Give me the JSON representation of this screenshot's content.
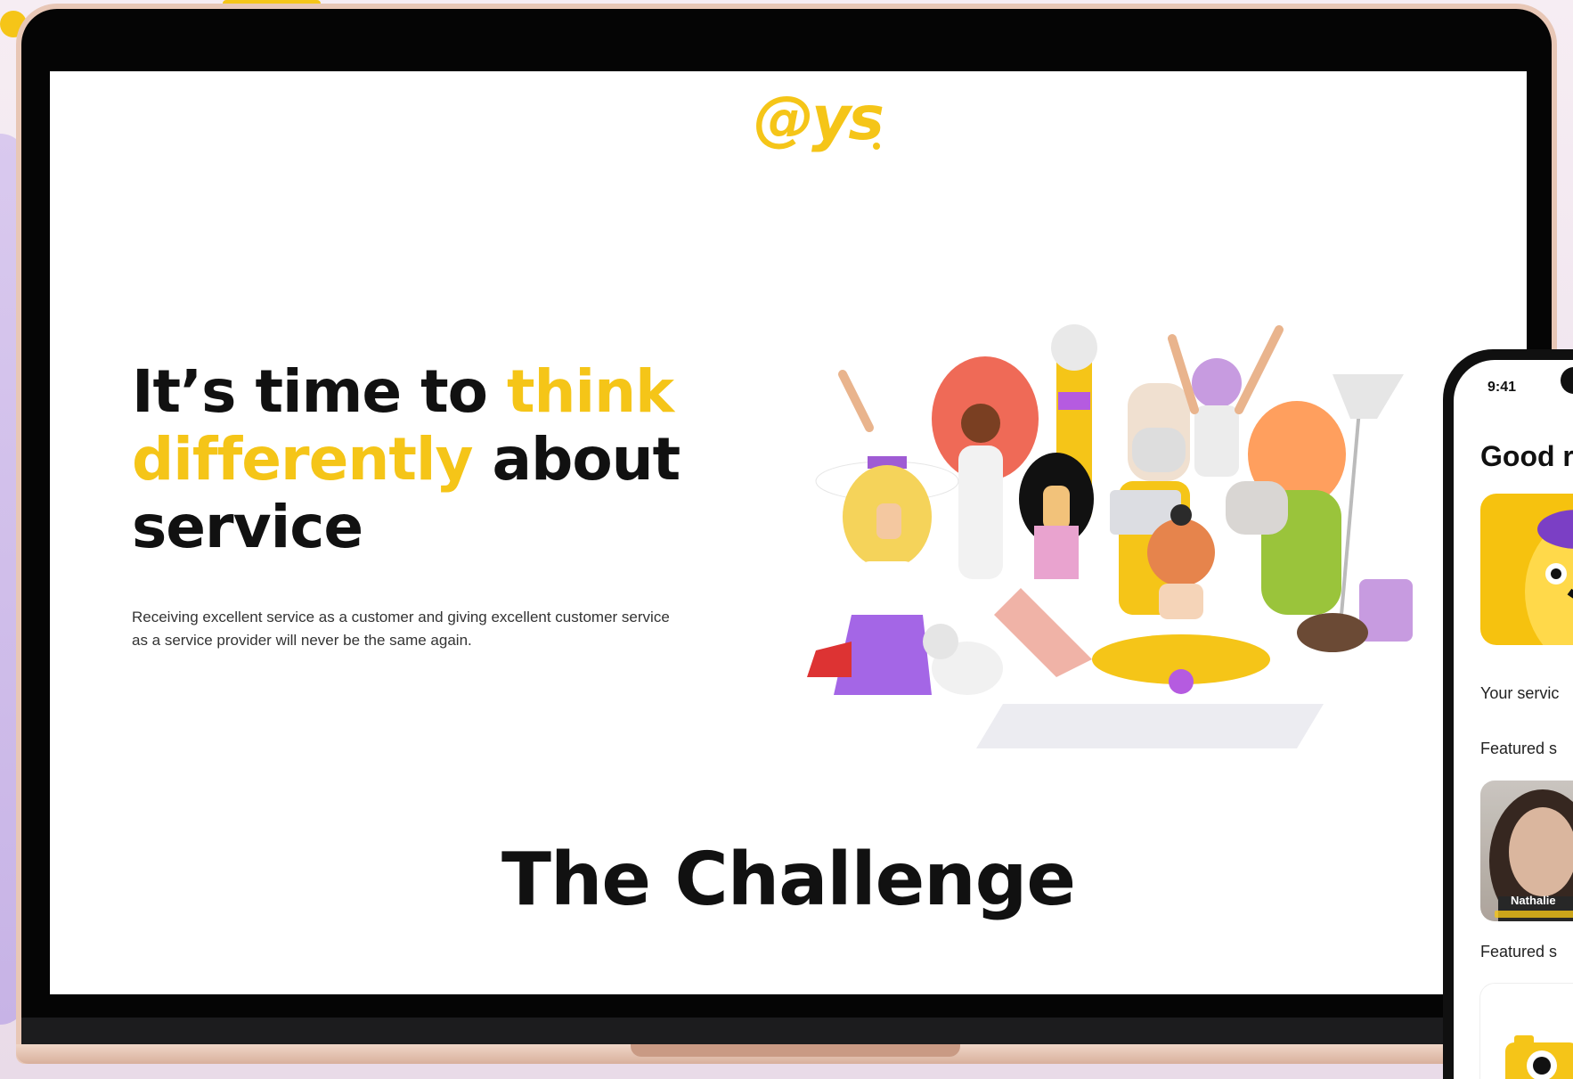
{
  "site": {
    "logo": "@ys",
    "hero": {
      "title_part1": "It’s time to ",
      "title_highlight1": "think",
      "title_highlight2": "differently",
      "title_part2": " about",
      "title_part3": "service",
      "subtitle": "Receiving excellent service as a customer and giving excellent customer service as a service provider will never be the same again."
    },
    "section_title": "The Challenge"
  },
  "phone": {
    "time": "9:41",
    "greeting": "Good r",
    "your_services_label": "Your servic",
    "featured_label_1": "Featured s",
    "featured_person_name": "Nathalie",
    "featured_label_2": "Featured s"
  },
  "colors": {
    "brand_yellow": "#f5c518",
    "text_dark": "#111111",
    "laptop_rose_gold": "#e8c7b6"
  }
}
